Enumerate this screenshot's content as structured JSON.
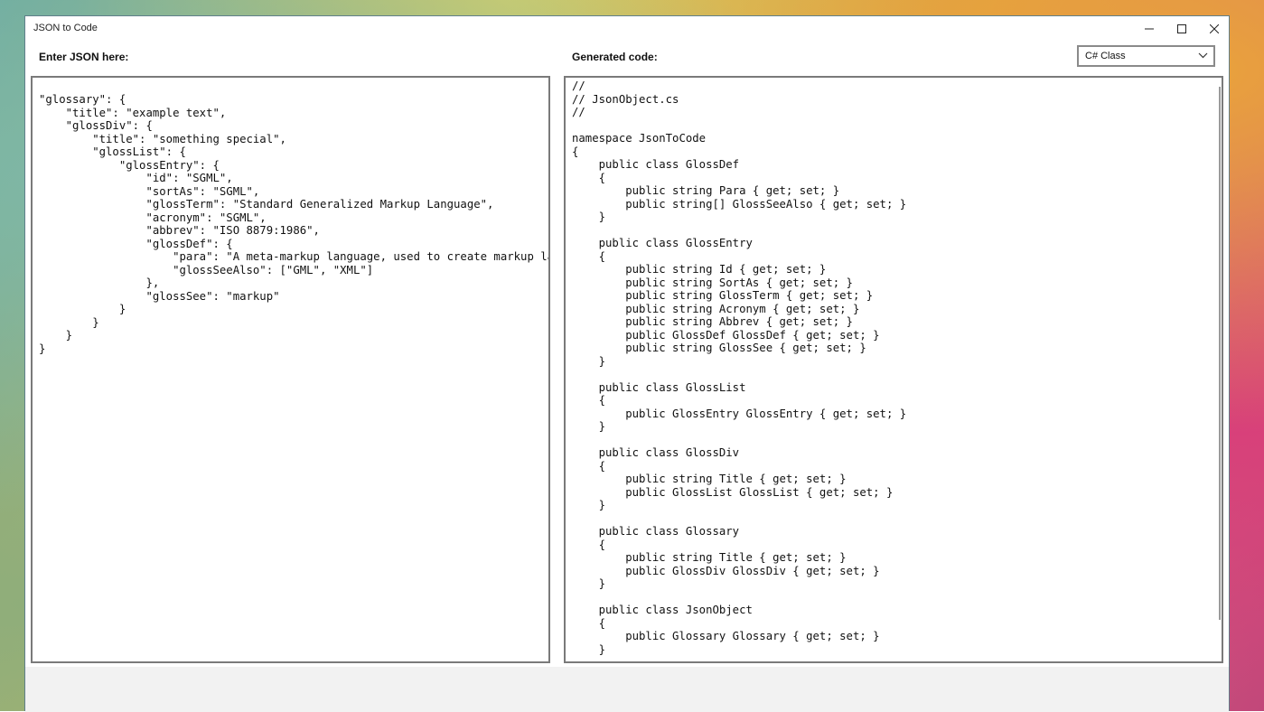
{
  "window": {
    "title": "JSON to Code"
  },
  "input": {
    "label": "Enter JSON here:",
    "text": "\"glossary\": {\n    \"title\": \"example text\",\n    \"glossDiv\": {\n        \"title\": \"something special\",\n        \"glossList\": {\n            \"glossEntry\": {\n                \"id\": \"SGML\",\n                \"sortAs\": \"SGML\",\n                \"glossTerm\": \"Standard Generalized Markup Language\",\n                \"acronym\": \"SGML\",\n                \"abbrev\": \"ISO 8879:1986\",\n                \"glossDef\": {\n                    \"para\": \"A meta-markup language, used to create markup languag\n                    \"glossSeeAlso\": [\"GML\", \"XML\"]\n                },\n                \"glossSee\": \"markup\"\n            }\n        }\n    }\n}"
  },
  "output": {
    "label": "Generated code:",
    "language": "C# Class",
    "code": "//\n// JsonObject.cs\n//\n\nnamespace JsonToCode\n{\n    public class GlossDef\n    {\n        public string Para { get; set; }\n        public string[] GlossSeeAlso { get; set; }\n    }\n\n    public class GlossEntry\n    {\n        public string Id { get; set; }\n        public string SortAs { get; set; }\n        public string GlossTerm { get; set; }\n        public string Acronym { get; set; }\n        public string Abbrev { get; set; }\n        public GlossDef GlossDef { get; set; }\n        public string GlossSee { get; set; }\n    }\n\n    public class GlossList\n    {\n        public GlossEntry GlossEntry { get; set; }\n    }\n\n    public class GlossDiv\n    {\n        public string Title { get; set; }\n        public GlossList GlossList { get; set; }\n    }\n\n    public class Glossary\n    {\n        public string Title { get; set; }\n        public GlossDiv GlossDiv { get; set; }\n    }\n\n    public class JsonObject\n    {\n        public Glossary Glossary { get; set; }\n    }"
  },
  "icons": {
    "minimize": "minimize-icon",
    "maximize": "maximize-icon",
    "close": "close-icon",
    "dropdown": "chevron-down-icon"
  }
}
